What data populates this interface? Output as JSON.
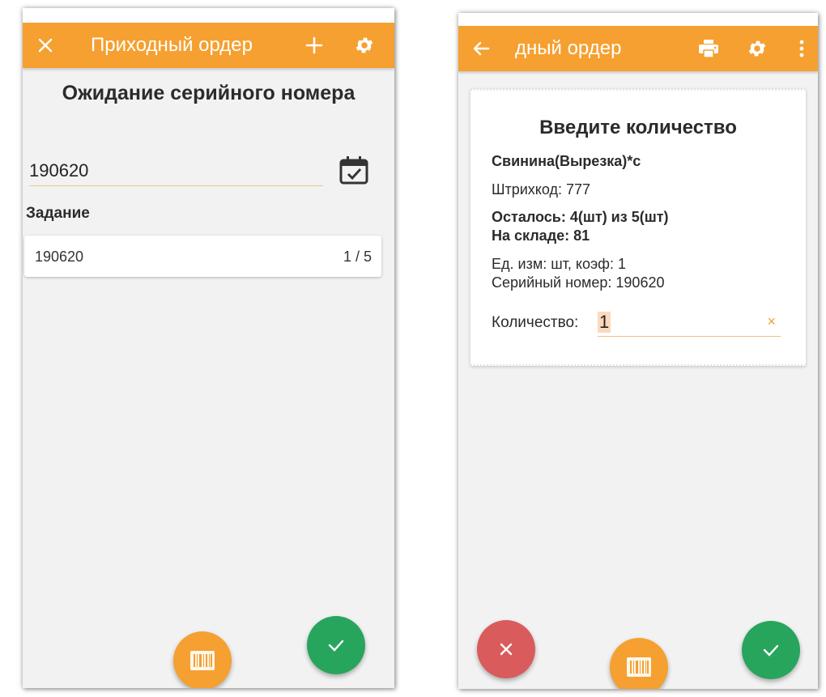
{
  "left_screen": {
    "appbar": {
      "title": "Приходный ордер",
      "icons": [
        "close-icon",
        "plus-icon",
        "gear-icon"
      ]
    },
    "heading": "Ожидание серийного номера",
    "serial_input": {
      "value": "190620"
    },
    "section_label": "Задание",
    "tasks": [
      {
        "name": "190620",
        "progress": "1 / 5"
      }
    ],
    "fabs": [
      "barcode-scan",
      "confirm"
    ]
  },
  "right_screen": {
    "appbar": {
      "title": "дный ордер",
      "icons": [
        "back-arrow-icon",
        "print-icon",
        "gear-icon",
        "more-vert-icon"
      ]
    },
    "dialog": {
      "title": "Введите количество",
      "product": "Свинина(Вырезка)*с",
      "barcode": "Штрихкод: 777",
      "remaining": "Осталось: 4(шт) из 5(шт)",
      "in_stock": "На складе: 81",
      "unit": "Ед. изм: шт, коэф: 1",
      "serial": "Серийный номер: 190620",
      "quantity_label": "Количество:",
      "quantity_value": "1",
      "clear_glyph": "×"
    },
    "fabs": [
      "cancel",
      "barcode-scan",
      "confirm"
    ]
  },
  "colors": {
    "accent": "#f5a030",
    "confirm": "#27a55d",
    "cancel": "#d95b5b",
    "background": "#f2f2f2"
  }
}
